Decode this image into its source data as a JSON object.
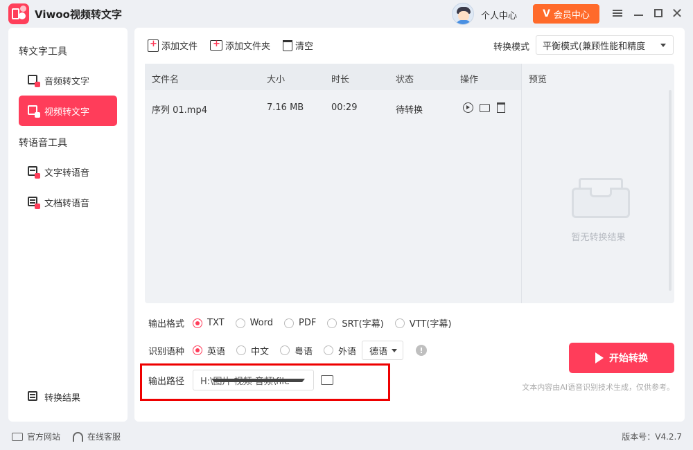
{
  "app": {
    "title": "Viwoo视频转文字"
  },
  "header": {
    "personal_center": "个人中心",
    "vip_label": "会员中心",
    "vip_symbol": "V"
  },
  "sidebar": {
    "group1_title": "转文字工具",
    "items1": [
      {
        "label": "音频转文字"
      },
      {
        "label": "视频转文字"
      }
    ],
    "group2_title": "转语音工具",
    "items2": [
      {
        "label": "文字转语音"
      },
      {
        "label": "文档转语音"
      }
    ],
    "result_label": "转换结果"
  },
  "toolbar": {
    "add_file": "添加文件",
    "add_folder": "添加文件夹",
    "clear": "清空",
    "mode_label": "转换模式",
    "mode_value": "平衡模式(兼顾性能和精度"
  },
  "table": {
    "headers": {
      "name": "文件名",
      "size": "大小",
      "duration": "时长",
      "status": "状态",
      "ops": "操作"
    },
    "rows": [
      {
        "name": "序列 01.mp4",
        "size": "7.16 MB",
        "duration": "00:29",
        "status": "待转换"
      }
    ]
  },
  "preview": {
    "title": "预览",
    "empty": "暂无转换结果"
  },
  "output_format": {
    "label": "输出格式",
    "options": [
      "TXT",
      "Word",
      "PDF",
      "SRT(字幕)",
      "VTT(字幕)"
    ],
    "selected": "TXT"
  },
  "recognition": {
    "label": "识别语种",
    "options": [
      "英语",
      "中文",
      "粤语",
      "外语"
    ],
    "selected": "英语",
    "foreign_value": "德语"
  },
  "output_path": {
    "label": "输出路径",
    "value": "H:\\图片 视频 音频\\file"
  },
  "start_button": "开始转换",
  "disclaimer": "文本内容由AI语音识别技术生成，仅供参考。",
  "footer": {
    "website": "官方网站",
    "support": "在线客服",
    "version": "版本号：V4.2.7"
  },
  "colors": {
    "accent": "#ff3d5a",
    "vip": "#ff6a2a",
    "highlight_box": "#ee0000"
  }
}
